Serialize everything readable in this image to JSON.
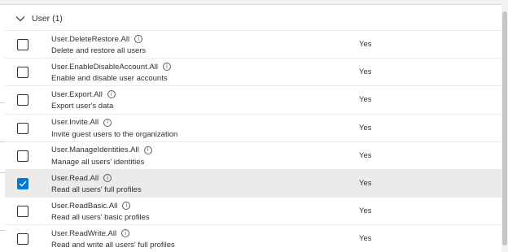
{
  "group": {
    "label": "User (1)",
    "chevron_icon": "chevron-down-icon"
  },
  "columns": {
    "admin_consent_value_label": "Yes"
  },
  "permissions": [
    {
      "name": "User.DeleteRestore.All",
      "description": "Delete and restore all users",
      "admin_consent": "Yes",
      "checked": false
    },
    {
      "name": "User.EnableDisableAccount.All",
      "description": "Enable and disable user accounts",
      "admin_consent": "Yes",
      "checked": false
    },
    {
      "name": "User.Export.All",
      "description": "Export user's data",
      "admin_consent": "Yes",
      "checked": false
    },
    {
      "name": "User.Invite.All",
      "description": "Invite guest users to the organization",
      "admin_consent": "Yes",
      "checked": false
    },
    {
      "name": "User.ManageIdentities.All",
      "description": "Manage all users' identities",
      "admin_consent": "Yes",
      "checked": false
    },
    {
      "name": "User.Read.All",
      "description": "Read all users' full profiles",
      "admin_consent": "Yes",
      "checked": true
    },
    {
      "name": "User.ReadBasic.All",
      "description": "Read all users' basic profiles",
      "admin_consent": "Yes",
      "checked": false
    },
    {
      "name": "User.ReadWrite.All",
      "description": "Read and write all users' full profiles",
      "admin_consent": "Yes",
      "checked": false
    }
  ],
  "info_icon": "info-icon",
  "accent_color": "#0078d4",
  "selected_row_color": "#edebe9"
}
